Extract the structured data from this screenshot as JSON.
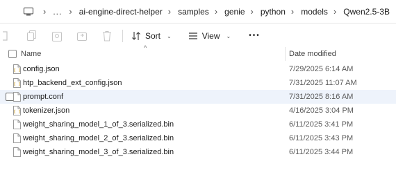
{
  "breadcrumb": {
    "ellipsis": "...",
    "items": [
      "ai-engine-direct-helper",
      "samples",
      "genie",
      "python",
      "models",
      "Qwen2.5-3B"
    ]
  },
  "toolbar": {
    "sort_label": "Sort",
    "view_label": "View",
    "more_label": "•••"
  },
  "columns": {
    "name": "Name",
    "date_modified": "Date modified"
  },
  "files": [
    {
      "name": "config.json",
      "date": "7/29/2025 6:14 AM",
      "icon": "file-json-icon"
    },
    {
      "name": "htp_backend_ext_config.json",
      "date": "7/31/2025 11:07 AM",
      "icon": "file-json-icon"
    },
    {
      "name": "prompt.conf",
      "date": "7/31/2025 8:16 AM",
      "icon": "file-icon",
      "selected": true
    },
    {
      "name": "tokenizer.json",
      "date": "4/16/2025 3:04 PM",
      "icon": "file-json-icon"
    },
    {
      "name": "weight_sharing_model_1_of_3.serialized.bin",
      "date": "6/11/2025 3:41 PM",
      "icon": "file-icon"
    },
    {
      "name": "weight_sharing_model_2_of_3.serialized.bin",
      "date": "6/11/2025 3:43 PM",
      "icon": "file-icon"
    },
    {
      "name": "weight_sharing_model_3_of_3.serialized.bin",
      "date": "6/11/2025 3:44 PM",
      "icon": "file-icon"
    }
  ],
  "colors": {
    "selection": "#eef3fb",
    "json_icon": "#c8a03a"
  }
}
